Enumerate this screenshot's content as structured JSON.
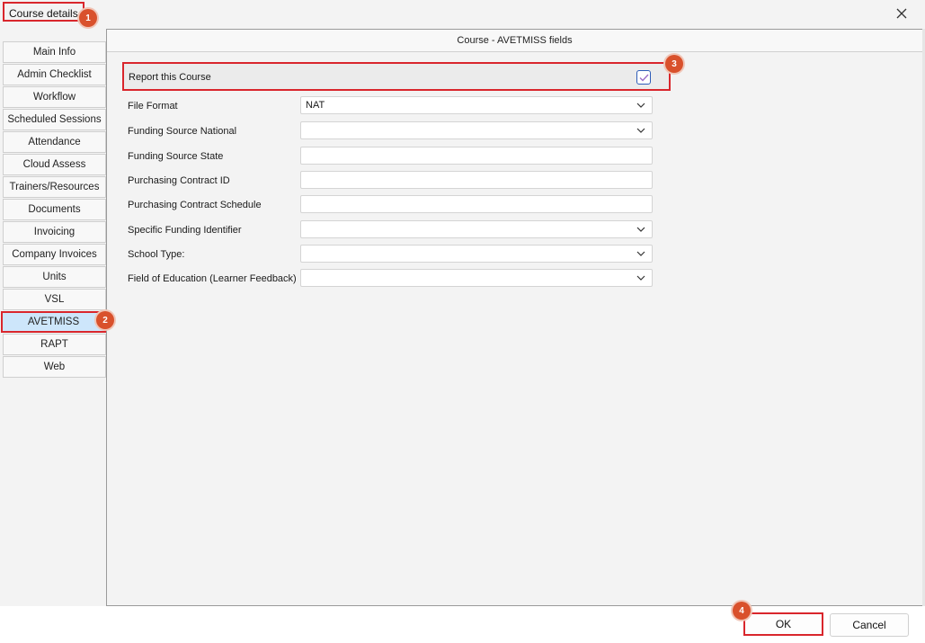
{
  "window": {
    "title": "Course details",
    "colors": {
      "accent_red": "#d9262c",
      "badge": "#d9512c",
      "active_tab": "#cde6fb",
      "checkbox": "#2e5cb8"
    }
  },
  "badges": [
    "1",
    "2",
    "3",
    "4"
  ],
  "tabs": [
    {
      "label": "Main Info"
    },
    {
      "label": "Admin Checklist"
    },
    {
      "label": "Workflow"
    },
    {
      "label": "Scheduled Sessions"
    },
    {
      "label": "Attendance"
    },
    {
      "label": "Cloud Assess"
    },
    {
      "label": "Trainers/Resources"
    },
    {
      "label": "Documents"
    },
    {
      "label": "Invoicing"
    },
    {
      "label": "Company Invoices"
    },
    {
      "label": "Units"
    },
    {
      "label": "VSL"
    },
    {
      "label": "AVETMISS",
      "active": true
    },
    {
      "label": "RAPT"
    },
    {
      "label": "Web"
    }
  ],
  "panel": {
    "header": "Course - AVETMISS fields",
    "report": {
      "label": "Report this Course",
      "checked": true
    },
    "fields": [
      {
        "label": "File Format",
        "type": "dropdown",
        "value": "NAT"
      },
      {
        "label": "Funding Source National",
        "type": "dropdown",
        "value": ""
      },
      {
        "label": "Funding Source State",
        "type": "text",
        "value": ""
      },
      {
        "label": "Purchasing Contract ID",
        "type": "text",
        "value": ""
      },
      {
        "label": "Purchasing Contract Schedule",
        "type": "text",
        "value": ""
      },
      {
        "label": "Specific Funding Identifier",
        "type": "dropdown",
        "value": ""
      },
      {
        "label": "School Type:",
        "type": "dropdown",
        "value": ""
      },
      {
        "label": "Field of Education (Learner Feedback)",
        "type": "dropdown",
        "value": ""
      }
    ]
  },
  "footer": {
    "ok_label": "OK",
    "cancel_label": "Cancel"
  },
  "icons": {
    "close": "close-icon",
    "check": "checkmark-icon",
    "chevron": "chevron-down-icon"
  }
}
